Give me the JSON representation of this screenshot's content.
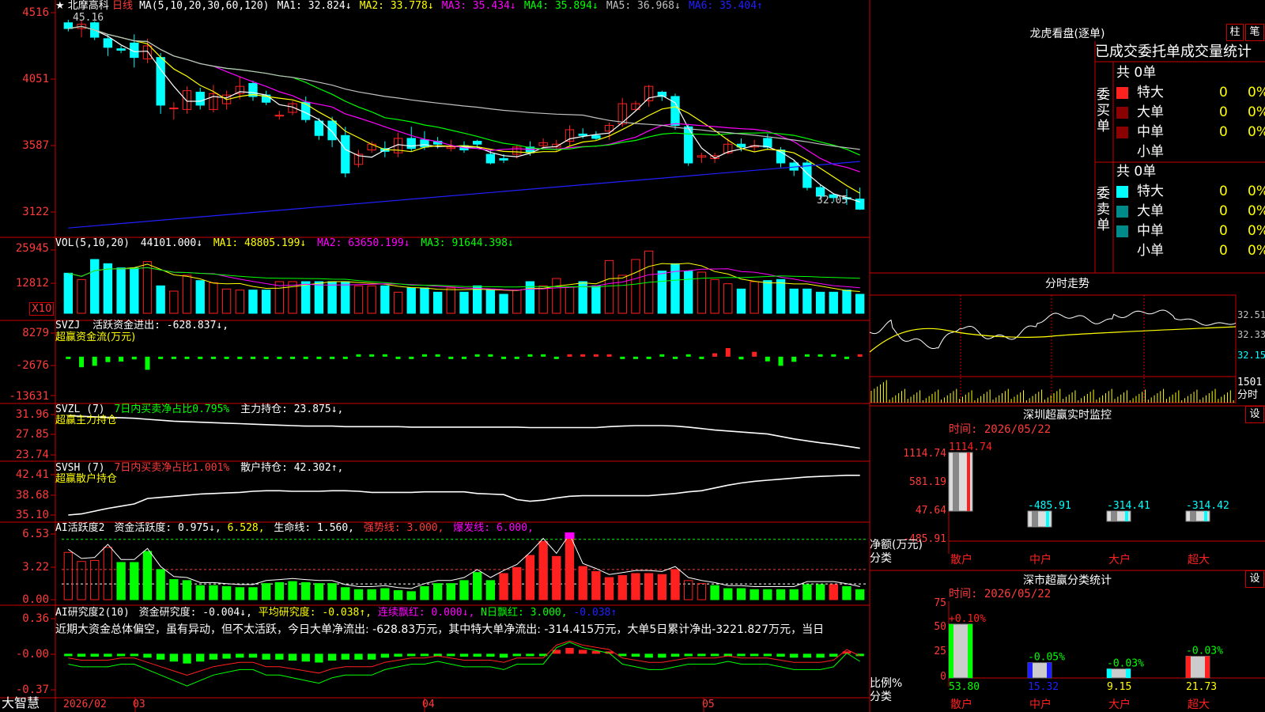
{
  "colors": {
    "up": "#ff2020",
    "down": "#00ffff",
    "grid": "#cc0000",
    "axis_text": "#ff3b3b",
    "ma1": "#ffffff",
    "ma2": "#ffff00",
    "ma3": "#ff00ff",
    "ma4": "#00ff00",
    "ma5": "#c0c0c0",
    "ma6": "#2020ff",
    "green": "#00ff00",
    "white": "#ffffff",
    "yellow": "#ffff00",
    "magenta": "#ff00ff"
  },
  "title": {
    "star": "★",
    "name": "北摩高科",
    "period": "日线"
  },
  "price_panel": {
    "ma_header": "MA(5,10,20,30,60,120)",
    "ma_labels": [
      "MA1: 32.824↓",
      "MA2: 33.778↓",
      "MA3: 35.434↓",
      "MA4: 35.894↓",
      "MA5: 36.968↓",
      "MA6: 35.404↑"
    ],
    "high_label": "45.16",
    "low_label": "32.05",
    "axis": [
      "4516",
      "4051",
      "3587",
      "3122"
    ]
  },
  "vol_panel": {
    "header": "VOL(5,10,20)",
    "value": "44101.000↓",
    "ma_labels": [
      "MA1: 48805.199↓",
      "MA2: 63650.199↓",
      "MA3: 91644.398↓"
    ],
    "axis": [
      "25945",
      "12812"
    ],
    "unit": "X10"
  },
  "svzj_panel": {
    "header": "SVZJ",
    "label": "活跃资金进出: -628.837↓,",
    "sub": "超赢资金流(万元)",
    "axis": [
      "8279",
      "-2676",
      "-13631"
    ]
  },
  "svzl_panel": {
    "header": "SVZL (7)",
    "label1": "7日内买卖净占比0.795%",
    "label2": "主力持仓: 23.875↓,",
    "sub": "超赢主力持仓",
    "axis": [
      "31.96",
      "27.85",
      "23.74"
    ]
  },
  "svsh_panel": {
    "header": "SVSH (7)",
    "label1": "7日内买卖净占比1.001%",
    "label2": "散户持仓: 42.302↑,",
    "sub": "超赢散户持仓",
    "axis": [
      "42.41",
      "38.68",
      "35.10"
    ]
  },
  "ai1_panel": {
    "header": "AI活跃度2",
    "label1": "资金活跃度: 0.975↓,",
    "label2": "6.528,",
    "label3": "生命线: 1.560,",
    "label4": "强势线: 3.000,",
    "label5": "爆发线: 6.000,",
    "axis": [
      "6.53",
      "3.22",
      "0.00"
    ]
  },
  "ai2_panel": {
    "header": "AI研究度2(10)",
    "label1": "资金研究度: -0.004↓,",
    "label2": "平均研究度: -0.038↑,",
    "label3": "连续飘红: 0.000↓,",
    "label4": "N日飘红: 3.000,",
    "label5": "-0.038↑",
    "desc": "近期大资金总体偏空，虽有异动，但不太活跃，今日大单净流出: -628.83万元，其中特大单净流出: -314.415万元，大单5日累计净出-3221.827万元，当日",
    "axis": [
      "0.36",
      "-0.00",
      "-0.37"
    ]
  },
  "x_axis": {
    "logo": "大智慧",
    "labels": [
      "2026/02",
      "03",
      "04",
      "05"
    ]
  },
  "right": {
    "lhkp_title": "龙虎看盘(逐单)",
    "btn1": "柱",
    "btn2": "笔",
    "stats_header": "已成交委托单成交量统计",
    "buy": {
      "side": "委买单",
      "total": "共 0单",
      "rows": [
        {
          "name": "特大",
          "count": "0",
          "pct": "0%"
        },
        {
          "name": "大单",
          "count": "0",
          "pct": "0%"
        },
        {
          "name": "中单",
          "count": "0",
          "pct": "0%"
        },
        {
          "name": "小单",
          "count": "",
          "pct": ""
        }
      ]
    },
    "sell": {
      "side": "委卖单",
      "total": "共 0单",
      "rows": [
        {
          "name": "特大",
          "count": "0",
          "pct": "0%"
        },
        {
          "name": "大单",
          "count": "0",
          "pct": "0%"
        },
        {
          "name": "中单",
          "count": "0",
          "pct": "0%"
        },
        {
          "name": "小单",
          "count": "0",
          "pct": "0%"
        }
      ]
    },
    "fenshi_title": "分时走势",
    "fenshi_axis": [
      "32.51",
      "32.33",
      "32.15"
    ],
    "fenshi_vol": [
      "1501",
      "分时"
    ],
    "sz_title": "深圳超赢实时监控",
    "sz_btn": "设",
    "sz_time": "时间: 2026/05/22",
    "sz_axis": [
      "1114.74",
      "581.19",
      "47.64",
      "-485.91"
    ],
    "sz_unit": [
      "净额(万元)",
      "分类"
    ],
    "sz_bars": [
      {
        "cat": "散户",
        "value": 1114.74,
        "label": "1114.74"
      },
      {
        "cat": "中户",
        "value": -485.91,
        "label": "-485.91"
      },
      {
        "cat": "大户",
        "value": -314.41,
        "label": "-314.41"
      },
      {
        "cat": "超大",
        "value": -314.42,
        "label": "-314.42"
      }
    ],
    "fl_title": "深市超赢分类统计",
    "fl_btn": "设",
    "fl_time": "时间: 2026/05/22",
    "fl_axis": [
      "75",
      "50",
      "25",
      "0"
    ],
    "fl_unit": [
      "比例%",
      "分类"
    ],
    "fl_bars": [
      {
        "cat": "散户",
        "value": 53.8,
        "label": "53.80",
        "chg": "+0.10%"
      },
      {
        "cat": "中户",
        "value": 15.32,
        "label": "15.32",
        "chg": "-0.05%"
      },
      {
        "cat": "大户",
        "value": 9.15,
        "label": "9.15",
        "chg": "-0.03%"
      },
      {
        "cat": "超大",
        "value": 21.73,
        "label": "21.73",
        "chg": "-0.03%"
      }
    ]
  },
  "chart_data": [
    {
      "type": "candlestick",
      "name": "price",
      "n": 61,
      "ohlc": [
        [
          45.0,
          45.2,
          44.4,
          44.6
        ],
        [
          44.6,
          45.16,
          44.0,
          44.9
        ],
        [
          45.0,
          45.1,
          43.8,
          44.0
        ],
        [
          43.9,
          44.2,
          42.7,
          43.3
        ],
        [
          43.2,
          43.4,
          42.9,
          43.1
        ],
        [
          43.6,
          44.2,
          41.9,
          42.6
        ],
        [
          42.5,
          43.9,
          42.2,
          43.4
        ],
        [
          42.6,
          42.9,
          38.7,
          39.3
        ],
        [
          39.1,
          39.5,
          38.3,
          39.1
        ],
        [
          39.0,
          40.6,
          38.7,
          40.3
        ],
        [
          40.2,
          40.5,
          39.0,
          39.3
        ],
        [
          39.0,
          40.7,
          38.8,
          40.1
        ],
        [
          39.4,
          40.3,
          39.0,
          40.0
        ],
        [
          40.1,
          41.3,
          39.7,
          40.6
        ],
        [
          40.8,
          41.0,
          39.6,
          39.9
        ],
        [
          40.0,
          40.3,
          39.3,
          39.5
        ],
        [
          38.6,
          38.9,
          38.3,
          38.6
        ],
        [
          38.8,
          39.6,
          38.6,
          39.4
        ],
        [
          39.5,
          39.9,
          38.1,
          38.3
        ],
        [
          38.2,
          38.4,
          36.9,
          37.2
        ],
        [
          38.2,
          38.5,
          36.4,
          36.9
        ],
        [
          37.2,
          37.8,
          34.3,
          34.6
        ],
        [
          35.2,
          36.2,
          35.0,
          35.9
        ],
        [
          36.2,
          36.8,
          36.0,
          36.6
        ],
        [
          36.3,
          36.8,
          35.7,
          36.1
        ],
        [
          36.0,
          37.4,
          35.7,
          37.0
        ],
        [
          37.0,
          37.8,
          36.1,
          36.3
        ],
        [
          36.9,
          37.5,
          36.2,
          36.4
        ],
        [
          36.8,
          37.1,
          36.3,
          36.6
        ],
        [
          36.3,
          36.9,
          36.1,
          36.4
        ],
        [
          36.5,
          36.8,
          36.0,
          36.2
        ],
        [
          36.8,
          36.9,
          36.3,
          36.6
        ],
        [
          35.9,
          36.2,
          35.2,
          35.3
        ],
        [
          35.6,
          35.9,
          35.3,
          35.5
        ],
        [
          35.9,
          36.5,
          35.6,
          36.4
        ],
        [
          36.4,
          36.8,
          35.8,
          36.0
        ],
        [
          36.5,
          37.0,
          36.3,
          36.7
        ],
        [
          36.4,
          36.9,
          36.1,
          36.6
        ],
        [
          36.8,
          37.9,
          36.5,
          37.6
        ],
        [
          37.3,
          37.7,
          37.0,
          37.2
        ],
        [
          37.2,
          37.5,
          36.9,
          37.0
        ],
        [
          37.5,
          38.1,
          36.9,
          37.9
        ],
        [
          38.0,
          39.8,
          37.8,
          39.4
        ],
        [
          39.0,
          39.6,
          38.9,
          39.4
        ],
        [
          39.6,
          40.7,
          39.2,
          40.6
        ],
        [
          40.2,
          40.3,
          39.6,
          39.9
        ],
        [
          39.9,
          40.1,
          37.6,
          37.9
        ],
        [
          37.8,
          38.0,
          35.1,
          35.3
        ],
        [
          35.7,
          36.0,
          35.3,
          35.8
        ],
        [
          35.6,
          36.0,
          35.3,
          35.8
        ],
        [
          36.0,
          37.0,
          35.9,
          36.6
        ],
        [
          36.6,
          37.0,
          36.1,
          36.4
        ],
        [
          36.4,
          36.9,
          36.1,
          36.5
        ],
        [
          37.0,
          37.3,
          36.2,
          36.4
        ],
        [
          36.2,
          36.4,
          35.0,
          35.3
        ],
        [
          35.3,
          35.5,
          34.4,
          34.8
        ],
        [
          35.3,
          35.5,
          33.4,
          33.6
        ],
        [
          33.6,
          33.8,
          32.8,
          33.0
        ],
        [
          33.1,
          33.2,
          32.6,
          32.9
        ],
        [
          32.9,
          33.5,
          32.4,
          32.8
        ],
        [
          32.8,
          33.6,
          32.05,
          32.1
        ]
      ],
      "ylim": [
        30.7,
        45.7
      ],
      "axis_labels": [
        "4516",
        "4051",
        "3587",
        "3122"
      ]
    },
    {
      "type": "bar",
      "name": "volume",
      "values": [
        190,
        160,
        255,
        235,
        215,
        215,
        245,
        130,
        105,
        180,
        155,
        145,
        115,
        110,
        110,
        110,
        150,
        150,
        150,
        150,
        150,
        150,
        130,
        130,
        130,
        100,
        120,
        120,
        100,
        120,
        100,
        130,
        110,
        90,
        110,
        150,
        130,
        165,
        125,
        150,
        130,
        250,
        180,
        255,
        295,
        200,
        235,
        200,
        195,
        160,
        140,
        115,
        150,
        155,
        160,
        115,
        115,
        100,
        100,
        110,
        90
      ],
      "ylim": [
        0,
        300
      ],
      "axis_labels": [
        "25945",
        "12812"
      ]
    },
    {
      "type": "bar",
      "name": "svzj",
      "values": [
        -250,
        -3700,
        -3200,
        -1900,
        -1700,
        -950,
        -4600,
        -650,
        -450,
        -550,
        -500,
        -250,
        -550,
        -600,
        -500,
        -200,
        -500,
        -650,
        -500,
        -450,
        -250,
        -450,
        0,
        0,
        0,
        -200,
        -350,
        0,
        0,
        -250,
        -100,
        0,
        0,
        -150,
        -100,
        0,
        0,
        -100,
        600,
        700,
        200,
        400,
        -150,
        -650,
        -500,
        0,
        -250,
        0,
        -200,
        1200,
        3000,
        -950,
        1700,
        -1650,
        -3200,
        -1800,
        0,
        0,
        0,
        -350,
        200
      ],
      "ylim": [
        -13631,
        8279
      ]
    },
    {
      "type": "line",
      "name": "svzl",
      "values": [
        31.7,
        31.6,
        31.5,
        31.4,
        31.3,
        31.2,
        31.0,
        30.8,
        30.6,
        30.5,
        30.4,
        30.3,
        30.2,
        30.1,
        30.0,
        29.9,
        29.8,
        29.7,
        29.6,
        29.6,
        29.6,
        29.5,
        29.5,
        29.5,
        29.5,
        29.5,
        29.4,
        29.4,
        29.4,
        29.4,
        29.4,
        29.4,
        29.4,
        29.4,
        29.4,
        29.3,
        29.3,
        29.3,
        29.3,
        29.3,
        29.3,
        29.5,
        29.6,
        29.7,
        29.7,
        29.7,
        29.6,
        29.4,
        29.1,
        28.8,
        28.6,
        28.4,
        28.2,
        28.0,
        27.5,
        27.0,
        26.6,
        26.2,
        25.9,
        25.5,
        25.1
      ],
      "ylim": [
        23.74,
        31.96
      ]
    },
    {
      "type": "line",
      "name": "svsh",
      "values": [
        35.1,
        35.3,
        35.8,
        36.3,
        36.7,
        37.1,
        38.1,
        38.3,
        38.5,
        38.7,
        38.9,
        39.0,
        39.1,
        39.2,
        39.4,
        39.5,
        39.5,
        39.4,
        39.4,
        39.4,
        39.5,
        39.5,
        39.4,
        39.2,
        39.2,
        39.2,
        39.2,
        39.3,
        39.3,
        39.3,
        39.3,
        39.0,
        38.9,
        38.8,
        37.9,
        37.6,
        37.8,
        38.2,
        38.5,
        38.6,
        38.6,
        38.6,
        38.6,
        38.6,
        38.6,
        38.8,
        39.0,
        39.3,
        39.5,
        40.0,
        40.5,
        40.9,
        41.2,
        41.4,
        41.6,
        41.8,
        42.0,
        42.1,
        42.2,
        42.3,
        42.3
      ],
      "ylim": [
        35.1,
        42.41
      ]
    },
    {
      "type": "bar",
      "name": "ai_activity",
      "values": [
        4.7,
        3.8,
        3.9,
        5.2,
        3.7,
        3.7,
        4.8,
        3.0,
        2.0,
        1.9,
        1.4,
        1.4,
        1.3,
        1.2,
        1.2,
        1.6,
        1.7,
        1.8,
        1.7,
        1.6,
        1.6,
        1.2,
        1.0,
        1.0,
        1.1,
        0.9,
        0.8,
        1.3,
        1.6,
        1.6,
        1.9,
        2.7,
        1.9,
        2.6,
        3.2,
        4.4,
        5.8,
        4.3,
        6.2,
        3.3,
        2.8,
        2.2,
        2.4,
        2.6,
        2.6,
        2.5,
        3.0,
        1.9,
        1.6,
        1.4,
        1.1,
        1.1,
        1.0,
        1.0,
        1.0,
        1.0,
        1.5,
        1.5,
        1.5,
        1.3,
        1.0
      ],
      "colors": [
        "h",
        "h",
        "h",
        "h",
        "g",
        "g",
        "g",
        "g",
        "g",
        "g",
        "g",
        "g",
        "g",
        "g",
        "g",
        "g",
        "g",
        "g",
        "g",
        "g",
        "g",
        "g",
        "g",
        "g",
        "g",
        "g",
        "g",
        "g",
        "g",
        "g",
        "g",
        "g",
        "g",
        "r",
        "r",
        "r",
        "r",
        "r",
        "r",
        "r",
        "r",
        "r",
        "r",
        "r",
        "r",
        "r",
        "r",
        "h",
        "h",
        "g",
        "g",
        "g",
        "g",
        "g",
        "g",
        "g",
        "g",
        "g",
        "r",
        "g",
        "g"
      ],
      "ylim": [
        0,
        6.53
      ]
    },
    {
      "type": "bar",
      "name": "ai_research",
      "values": [
        -0.02,
        -0.03,
        -0.03,
        -0.03,
        -0.02,
        -0.02,
        -0.04,
        -0.06,
        -0.08,
        -0.1,
        -0.08,
        -0.06,
        -0.05,
        -0.04,
        -0.04,
        -0.06,
        -0.06,
        -0.07,
        -0.08,
        -0.09,
        -0.07,
        -0.06,
        -0.06,
        -0.06,
        -0.04,
        -0.03,
        -0.02,
        -0.02,
        -0.01,
        -0.02,
        -0.03,
        -0.03,
        -0.03,
        -0.04,
        -0.02,
        -0.02,
        -0.02,
        0.04,
        0.06,
        0.04,
        0.03,
        0.02,
        -0.02,
        -0.03,
        -0.04,
        -0.04,
        -0.03,
        -0.02,
        -0.02,
        -0.02,
        -0.01,
        -0.02,
        -0.02,
        -0.02,
        -0.03,
        -0.04,
        -0.04,
        -0.04,
        -0.03,
        0.02,
        -0.01
      ],
      "ylim": [
        -0.37,
        0.36
      ]
    }
  ]
}
